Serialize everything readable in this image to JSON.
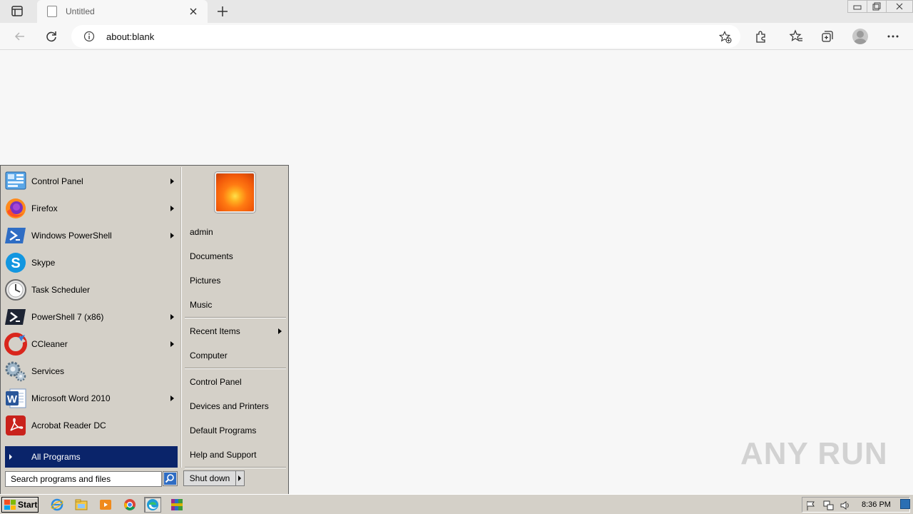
{
  "browser": {
    "tab_title": "Untitled",
    "url": "about:blank"
  },
  "start_menu": {
    "programs": [
      {
        "label": "Control Panel",
        "icon": "control-panel-icon",
        "has_submenu": true
      },
      {
        "label": "Firefox",
        "icon": "firefox-icon",
        "has_submenu": true
      },
      {
        "label": "Windows PowerShell",
        "icon": "powershell-icon",
        "has_submenu": true
      },
      {
        "label": "Skype",
        "icon": "skype-icon",
        "has_submenu": false
      },
      {
        "label": "Task Scheduler",
        "icon": "task-scheduler-icon",
        "has_submenu": false
      },
      {
        "label": "PowerShell 7 (x86)",
        "icon": "powershell7-icon",
        "has_submenu": true
      },
      {
        "label": "CCleaner",
        "icon": "ccleaner-icon",
        "has_submenu": true
      },
      {
        "label": "Services",
        "icon": "services-icon",
        "has_submenu": false
      },
      {
        "label": "Microsoft Word 2010",
        "icon": "word-icon",
        "has_submenu": true
      },
      {
        "label": "Acrobat Reader DC",
        "icon": "acrobat-icon",
        "has_submenu": false
      }
    ],
    "all_programs": "All Programs",
    "search_placeholder": "Search programs and files",
    "right_items": {
      "user": "admin",
      "documents": "Documents",
      "pictures": "Pictures",
      "music": "Music",
      "recent": "Recent Items",
      "computer": "Computer",
      "control_panel": "Control Panel",
      "devices": "Devices and Printers",
      "defaults": "Default Programs",
      "help": "Help and Support"
    },
    "shutdown": "Shut down"
  },
  "taskbar": {
    "start": "Start",
    "clock": "8:36 PM"
  },
  "watermark": "ANY RUN"
}
